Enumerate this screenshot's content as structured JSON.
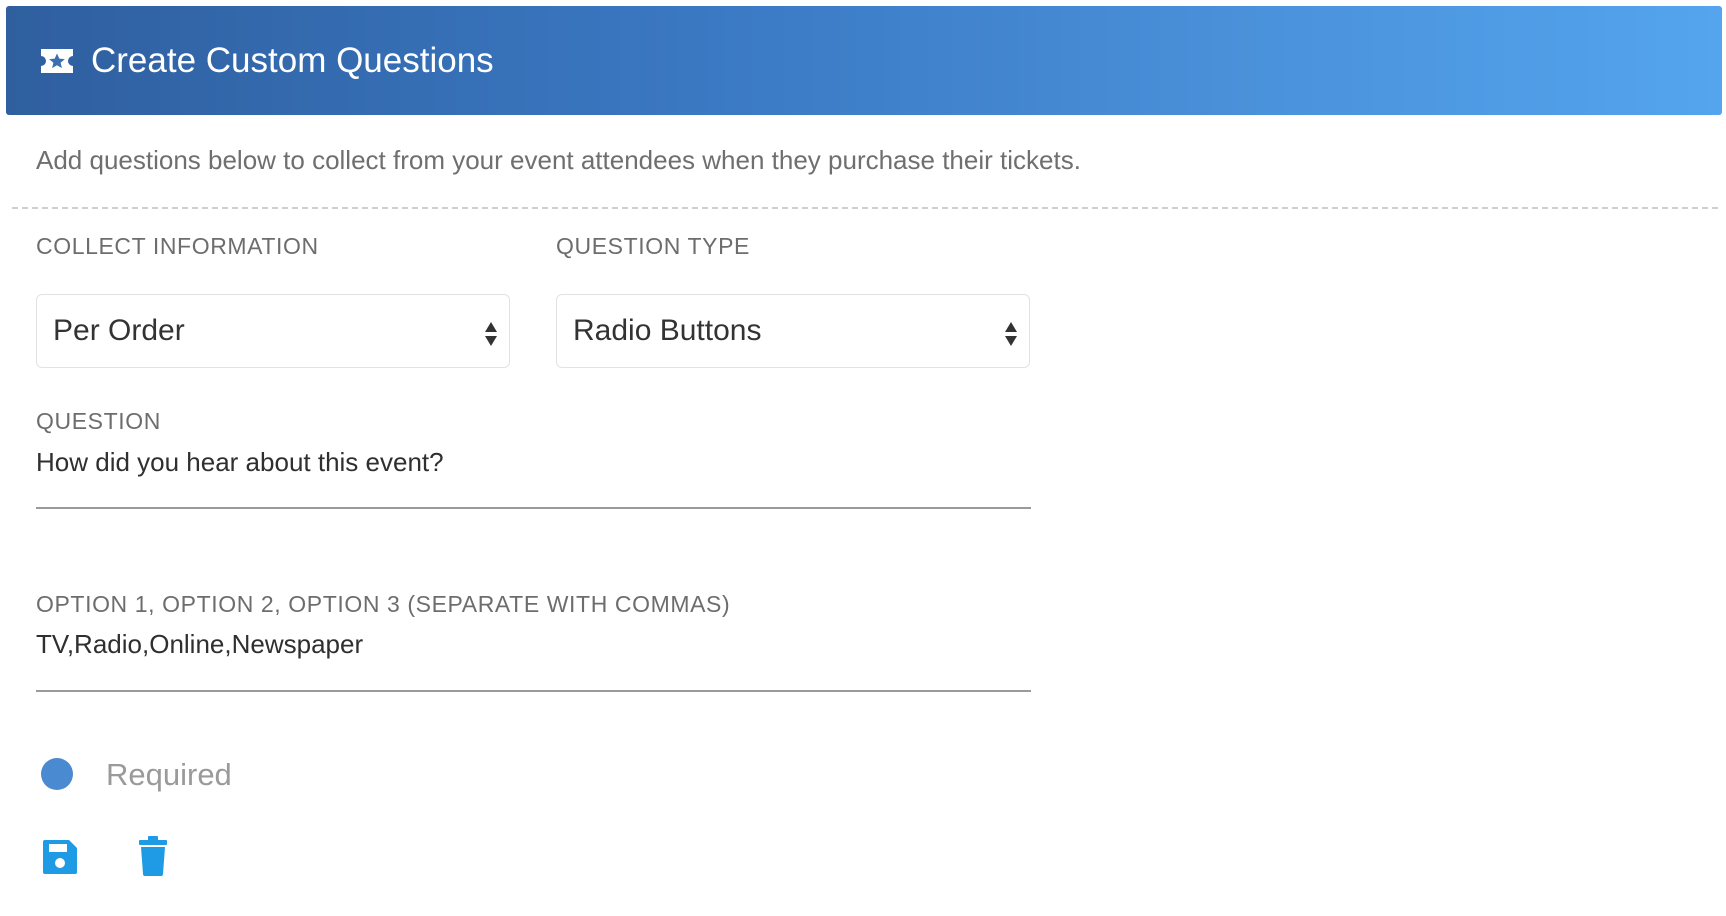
{
  "header": {
    "title": "Create Custom Questions",
    "icon": "ticket-star-icon",
    "gradient_start": "#2f5f9f",
    "gradient_end": "#54a4ee"
  },
  "intro_text": "Add questions below to collect from your event attendees when they purchase their tickets.",
  "collect_information": {
    "label": "COLLECT INFORMATION",
    "selected": "Per Order"
  },
  "question_type": {
    "label": "QUESTION TYPE",
    "selected": "Radio Buttons"
  },
  "question": {
    "label": "QUESTION",
    "value": "How did you hear about this event?"
  },
  "options": {
    "label": "OPTION 1, OPTION 2, OPTION 3 (SEPARATE WITH COMMAS)",
    "value": "TV,Radio,Online,Newspaper"
  },
  "required": {
    "label": "Required",
    "toggle_color": "#4a8ad0"
  },
  "actions": {
    "save_icon": "floppy-disk-icon",
    "delete_icon": "trash-icon",
    "icon_color": "#1e9be4"
  }
}
